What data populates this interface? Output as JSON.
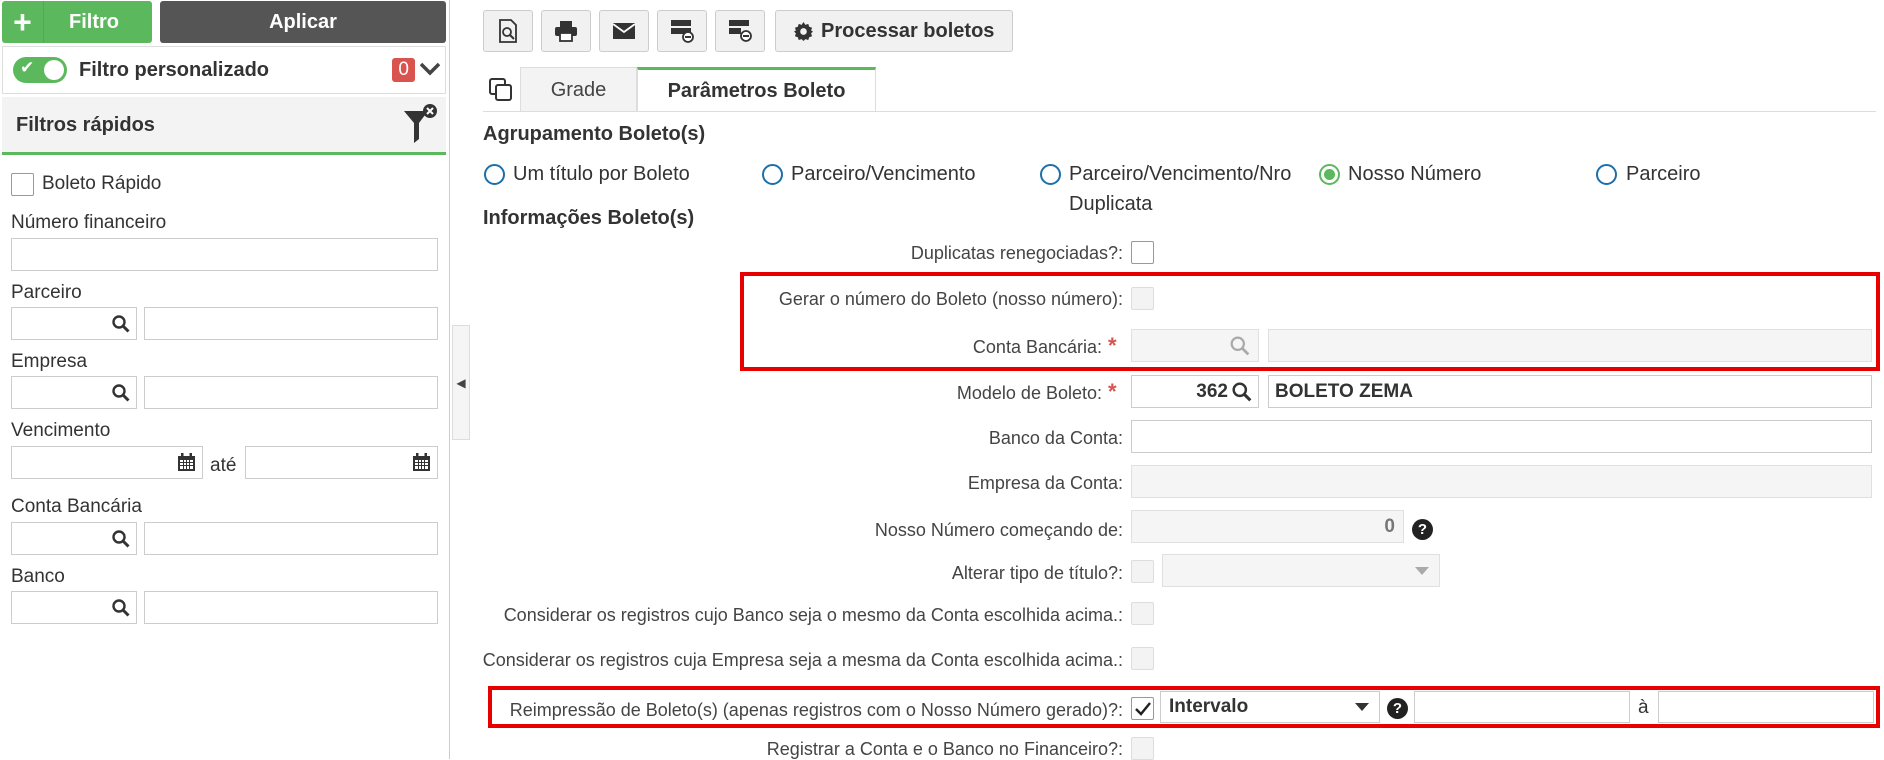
{
  "sidebar": {
    "filtro_label": "Filtro",
    "aplicar_label": "Aplicar",
    "custom_filter_label": "Filtro personalizado",
    "custom_filter_count": "0",
    "quick_filters_title": "Filtros rápidos",
    "boleto_rapido_label": "Boleto Rápido",
    "numero_financeiro_label": "Número financeiro",
    "parceiro_label": "Parceiro",
    "empresa_label": "Empresa",
    "vencimento_label": "Vencimento",
    "ate_label": "até",
    "conta_bancaria_label": "Conta Bancária",
    "banco_label": "Banco"
  },
  "toolbar": {
    "processar_label": "Processar boletos"
  },
  "tabs": {
    "grade": "Grade",
    "parametros": "Parâmetros Boleto"
  },
  "agrupamento": {
    "title": "Agrupamento Boleto(s)",
    "options": [
      "Um título por Boleto",
      "Parceiro/Vencimento",
      "Parceiro/Vencimento/Nro",
      "Duplicata",
      "Nosso Número",
      "Parceiro"
    ],
    "selected": "Nosso Número"
  },
  "informacoes": {
    "title": "Informações Boleto(s)",
    "duplicatas_label": "Duplicatas renegociadas?:",
    "gerar_numero_label": "Gerar o número do Boleto (nosso número):",
    "conta_bancaria_label": "Conta Bancária:",
    "modelo_label": "Modelo de Boleto:",
    "modelo_code": "362",
    "modelo_name": "BOLETO ZEMA",
    "banco_conta_label": "Banco da Conta:",
    "empresa_conta_label": "Empresa da Conta:",
    "nosso_numero_label": "Nosso Número começando de:",
    "nosso_numero_value": "0",
    "alterar_tipo_label": "Alterar tipo de título?:",
    "considerar_banco_label": "Considerar os registros cujo Banco seja o mesmo da Conta escolhida acima.:",
    "considerar_empresa_label": "Considerar os registros cuja Empresa seja a mesma da Conta escolhida acima.:",
    "reimpressao_label": "Reimpressão de Boleto(s) (apenas registros com o Nosso Número gerado)?:",
    "reimpressao_select": "Intervalo",
    "range_sep": "à",
    "registrar_label": "Registrar a Conta e o Banco no Financeiro?:"
  },
  "colors": {
    "accent_green": "#5cb85c",
    "dark_button": "#555555",
    "badge_red": "#d9534f",
    "highlight_red": "#e60000",
    "radio_blue": "#1f6ea8"
  }
}
